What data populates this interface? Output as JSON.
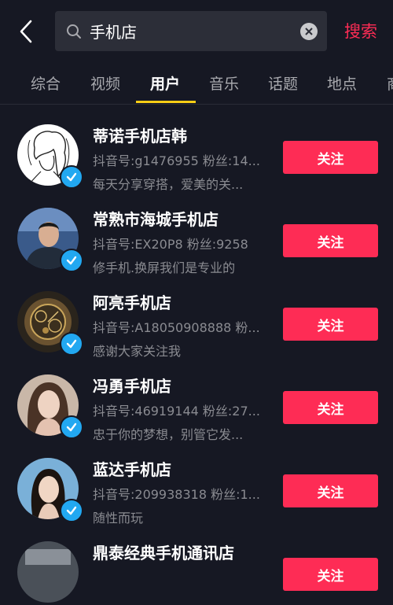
{
  "search": {
    "query": "手机店",
    "action_label": "搜索"
  },
  "tabs": [
    {
      "label": "综合"
    },
    {
      "label": "视频"
    },
    {
      "label": "用户"
    },
    {
      "label": "音乐"
    },
    {
      "label": "话题"
    },
    {
      "label": "地点"
    },
    {
      "label": "商"
    }
  ],
  "active_tab": "用户",
  "colors": {
    "background": "#161823",
    "accent": "#fe2c55",
    "tab_indicator": "#face15",
    "verified": "#22a8f1"
  },
  "users": [
    {
      "name": "蒂诺手机店韩",
      "meta": "抖音号:g1476955 粉丝:14...",
      "signature": "每天分享穿搭，爱美的关...",
      "follow_label": "关注",
      "verified": true,
      "avatar": "sketch-portrait"
    },
    {
      "name": "常熟市海城手机店",
      "meta": "抖音号:EX20P8 粉丝:9258",
      "signature": "修手机.换屏我们是专业的",
      "follow_label": "关注",
      "verified": true,
      "avatar": "man-photo"
    },
    {
      "name": "阿亮手机店",
      "meta": "抖音号:A18050908888 粉...",
      "signature": "感谢大家关注我",
      "follow_label": "关注",
      "verified": true,
      "avatar": "watch-photo"
    },
    {
      "name": "冯勇手机店",
      "meta": "抖音号:46919144 粉丝:27...",
      "signature": "忠于你的梦想，别管它发...",
      "follow_label": "关注",
      "verified": true,
      "avatar": "woman-photo"
    },
    {
      "name": "蓝达手机店",
      "meta": "抖音号:209938318 粉丝:1...",
      "signature": "随性而玩",
      "follow_label": "关注",
      "verified": true,
      "avatar": "woman-photo-2"
    },
    {
      "name": "鼎泰经典手机通讯店",
      "meta": "",
      "signature": "",
      "follow_label": "关注",
      "verified": false,
      "avatar": "photo"
    }
  ]
}
